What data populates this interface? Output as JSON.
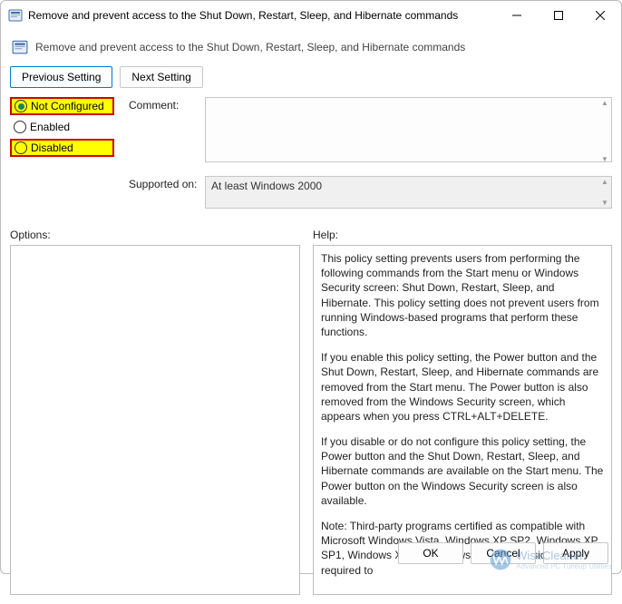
{
  "titlebar": {
    "title": "Remove and prevent access to the Shut Down, Restart, Sleep, and Hibernate commands"
  },
  "subtitle": "Remove and prevent access to the Shut Down, Restart, Sleep, and Hibernate commands",
  "nav": {
    "previous": "Previous Setting",
    "next": "Next Setting"
  },
  "radios": {
    "not_configured": "Not Configured",
    "enabled": "Enabled",
    "disabled": "Disabled",
    "selected": "not_configured"
  },
  "fields": {
    "comment_label": "Comment:",
    "comment_value": "",
    "supported_label": "Supported on:",
    "supported_value": "At least Windows 2000"
  },
  "lower": {
    "options_label": "Options:",
    "help_label": "Help:"
  },
  "help_text": {
    "p1": "This policy setting prevents users from performing the following commands from the Start menu or Windows Security screen: Shut Down, Restart, Sleep, and Hibernate. This policy setting does not prevent users from running Windows-based programs that perform these functions.",
    "p2": "If you enable this policy setting, the Power button and the Shut Down, Restart, Sleep, and Hibernate commands are removed from the Start menu. The Power button is also removed from the Windows Security screen, which appears when you press CTRL+ALT+DELETE.",
    "p3": "If you disable or do not configure this policy setting, the Power button and the Shut Down, Restart, Sleep, and Hibernate commands are available on the Start menu. The Power button on the Windows Security screen is also available.",
    "p4": "Note: Third-party programs certified as compatible with Microsoft Windows Vista, Windows XP SP2, Windows XP SP1, Windows XP, or Windows 2000 Professional are required to"
  },
  "footer": {
    "ok": "OK",
    "cancel": "Cancel",
    "apply": "Apply"
  },
  "watermark": {
    "line1": "WiseCleaner",
    "line2": "Advanced PC Tuneup Utilities"
  }
}
